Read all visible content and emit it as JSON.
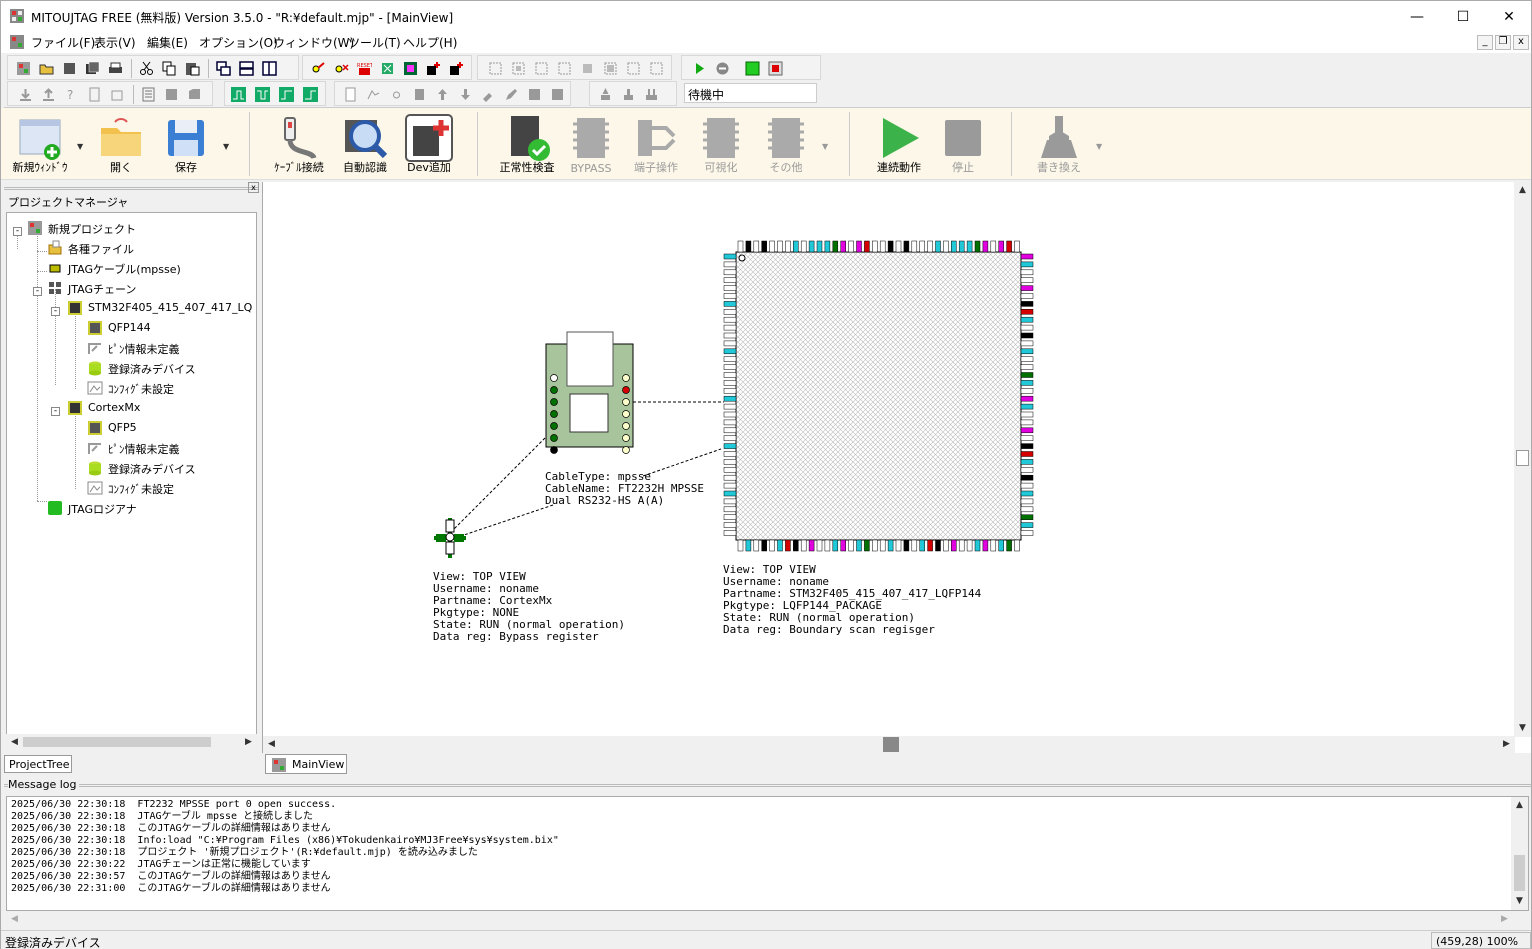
{
  "window": {
    "title": "MITOUJTAG FREE (無料版) Version 3.5.0 - \"R:¥default.mjp\" - [MainView]",
    "min_glyph": "—",
    "max_glyph": "☐",
    "close_glyph": "✕"
  },
  "menu": {
    "items": [
      "ファイル(F)",
      "表示(V)",
      "編集(E)",
      "オプション(O)",
      "ウィンドウ(W)",
      "ツール(T)",
      "ヘルプ(H)"
    ],
    "mdi_min": "_",
    "mdi_restore": "❐",
    "mdi_close": "x"
  },
  "toolbar": {
    "status_value": "待機中"
  },
  "ribbon": {
    "new_window": "新規ｳｨﾝﾄﾞｳ",
    "open": "開く",
    "save": "保存",
    "cable_connect": "ｹｰﾌﾞﾙ接続",
    "auto_detect": "自動認識",
    "dev_add": "Dev追加",
    "normality_check": "正常性検査",
    "bypass": "BYPASS",
    "pin_operation": "端子操作",
    "visualize": "可視化",
    "other": "その他",
    "continuous_run": "連続動作",
    "stop": "停止",
    "rewrite": "書き換え",
    "dropdown_glyph": "▼"
  },
  "project_manager": {
    "title": "プロジェクトマネージャ",
    "close_glyph": "x",
    "tree": {
      "root": "新規プロジェクト",
      "files": "各種ファイル",
      "cable": "JTAGケーブル(mpsse)",
      "chain": "JTAGチェーン",
      "device1": "STM32F405_415_407_417_LQ",
      "device1_pkg": "QFP144",
      "device1_pin": "ﾋﾟﾝ情報未定義",
      "device1_reg": "登録済みデバイス",
      "device1_cfg": "ｺﾝﾌｨｸﾞ未設定",
      "device2": "CortexMx",
      "device2_pkg": "QFP5",
      "device2_pin": "ﾋﾟﾝ情報未定義",
      "device2_reg": "登録済みデバイス",
      "device2_cfg": "ｺﾝﾌｨｸﾞ未設定",
      "logic_analyzer": "JTAGロジアナ"
    },
    "tab": "ProjectTree"
  },
  "main_view": {
    "tab": "MainView",
    "cable_info": {
      "line1": "CableType: mpsse",
      "line2": "CableName: FT2232H MPSSE",
      "line3": "Dual RS232-HS A(A)"
    },
    "cortex_info": {
      "line1": "View: TOP VIEW",
      "line2": "Username: noname",
      "line3": "Partname: CortexMx",
      "line4": "Pkgtype: NONE",
      "line5": "State: RUN (normal operation)",
      "line6": "Data reg: Bypass register"
    },
    "stm_info": {
      "line1": "View: TOP VIEW",
      "line2": "Username: noname",
      "line3": "Partname: STM32F405_415_407_417_LQFP144",
      "line4": "Pkgtype: LQFP144_PACKAGE",
      "line5": "State: RUN (normal operation)",
      "line6": "Data reg: Boundary scan regisger"
    },
    "pin_colors": {
      "red": "#d40000",
      "magenta": "#e000e0",
      "cyan": "#20c8d8",
      "green": "#007000",
      "black": "#000000",
      "white": "#ffffff"
    }
  },
  "message_log": {
    "title": "Message log",
    "lines": [
      "2025/06/30 22:30:18  FT2232 MPSSE port 0 open success.",
      "2025/06/30 22:30:18  JTAGケーブル mpsse と接続しました",
      "2025/06/30 22:30:18  このJTAGケーブルの詳細情報はありません",
      "2025/06/30 22:30:18  Info:load \"C:¥Program Files (x86)¥Tokudenkairo¥MJ3Free¥sys¥system.bix\"",
      "2025/06/30 22:30:18  プロジェクト '新規プロジェクト'(R:¥default.mjp) を読み込みました",
      "2025/06/30 22:30:22  JTAGチェーンは正常に機能しています",
      "2025/06/30 22:30:57  このJTAGケーブルの詳細情報はありません",
      "2025/06/30 22:31:00  このJTAGケーブルの詳細情報はありません"
    ]
  },
  "statusbar": {
    "left": "登録済みデバイス",
    "right": "(459,28) 100%"
  }
}
